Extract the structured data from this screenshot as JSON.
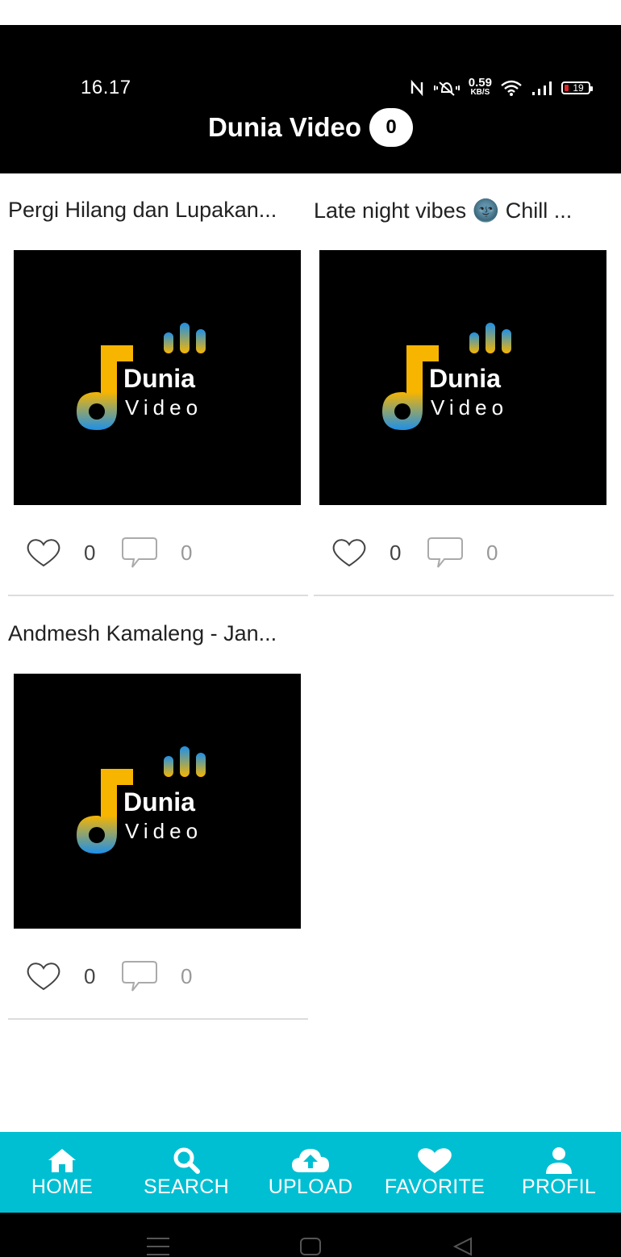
{
  "status_bar": {
    "time": "16.17",
    "net_speed": "0.59",
    "net_unit": "KB/S",
    "battery": "19"
  },
  "header": {
    "title": "Dunia Video",
    "badge_count": "0"
  },
  "logo": {
    "brand": "Dunia",
    "sub": "Video"
  },
  "videos": [
    {
      "title": "Pergi Hilang dan Lupakan...",
      "likes": "0",
      "comments": "0"
    },
    {
      "title": "Late night vibes 🌚 Chill ...",
      "likes": "0",
      "comments": "0"
    },
    {
      "title": "Andmesh Kamaleng - Jan...",
      "likes": "0",
      "comments": "0"
    }
  ],
  "nav": {
    "home": "HOME",
    "search": "SEARCH",
    "upload": "UPLOAD",
    "favorite": "FAVORITE",
    "profil": "PROFIL"
  },
  "colors": {
    "header_bg": "#000000",
    "nav_bg": "#00bfd3",
    "logo_yellow": "#f7b500",
    "logo_blue": "#1e90e8"
  }
}
